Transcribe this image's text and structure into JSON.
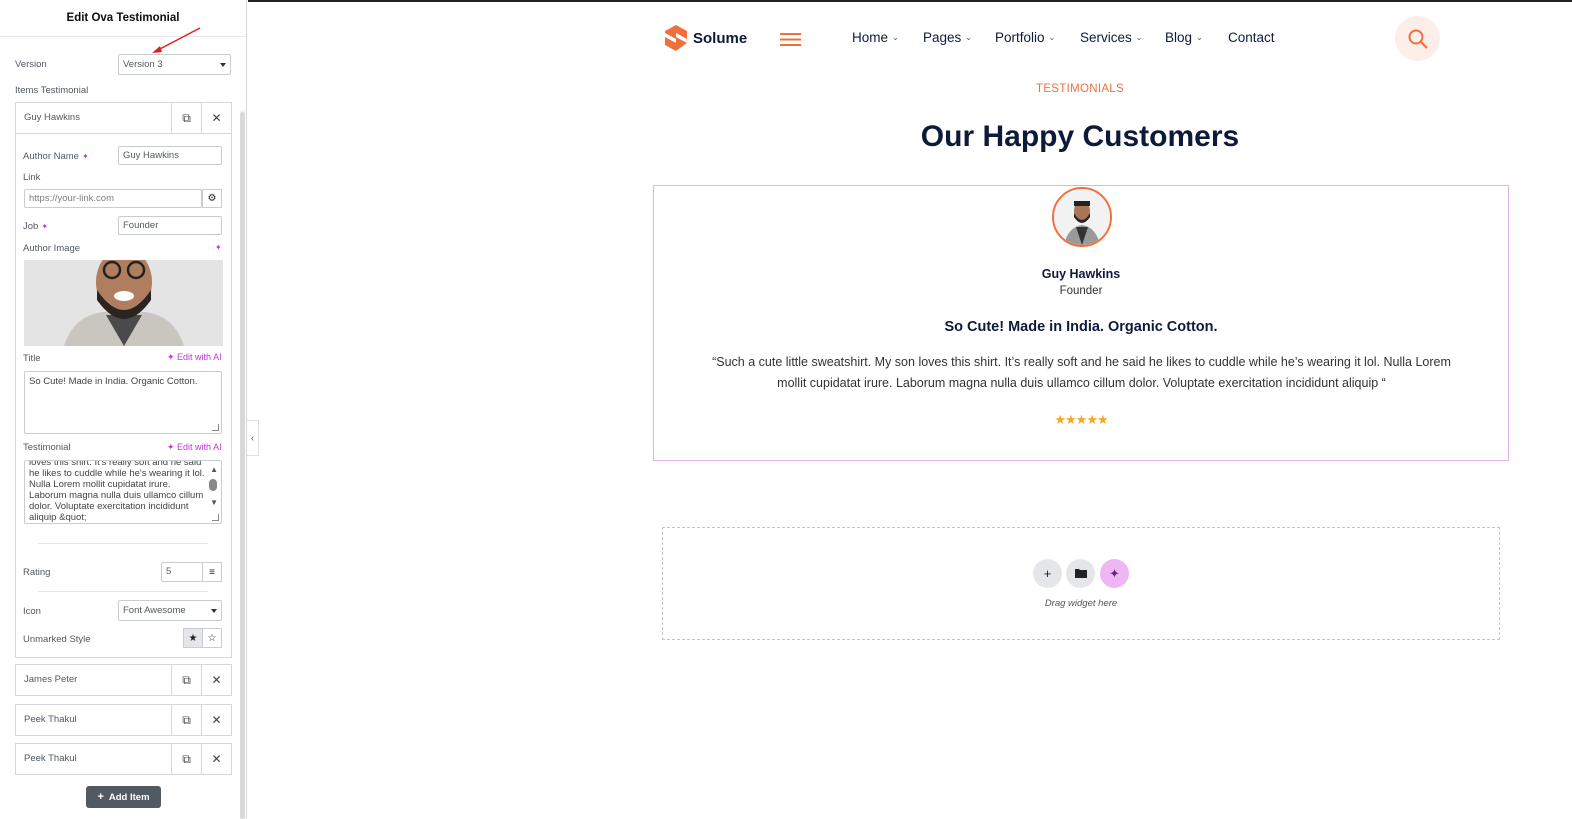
{
  "panel": {
    "title": "Edit Ova Testimonial",
    "version_label": "Version",
    "version_value": "Version 3",
    "items_label": "Items Testimonial",
    "items": [
      {
        "title": "Guy Hawkins"
      },
      {
        "title": "James Peter"
      },
      {
        "title": "Peek Thakul"
      },
      {
        "title": "Peek Thakul"
      }
    ],
    "fields": {
      "author_name_label": "Author Name",
      "author_name_value": "Guy Hawkins",
      "link_label": "Link",
      "link_placeholder": "https://your-link.com",
      "job_label": "Job",
      "job_value": "Founder",
      "author_image_label": "Author Image",
      "title_label": "Title",
      "title_value": "So Cute! Made in India. Organic Cotton.",
      "edit_with_ai": "Edit with AI",
      "testimonial_label": "Testimonial",
      "testimonial_value": "loves this shirt. It's really soft and he said he likes to cuddle while he's wearing it lol. Nulla Lorem mollit cupidatat irure. Laborum magna nulla duis ullamco cillum dolor. Voluptate exercitation incididunt aliquip &quot;",
      "rating_label": "Rating",
      "rating_value": "5",
      "icon_label": "Icon",
      "icon_value": "Font Awesome",
      "unmarked_style_label": "Unmarked Style"
    },
    "add_item_label": "Add Item"
  },
  "site": {
    "brand": "Solume",
    "brand_color": "#f0703d",
    "nav": [
      "Home",
      "Pages",
      "Portfolio",
      "Services",
      "Blog",
      "Contact"
    ]
  },
  "section": {
    "kicker": "TESTIMONIALS",
    "heading": "Our Happy Customers",
    "author_name": "Guy Hawkins",
    "author_job": "Founder",
    "title": "So Cute! Made in India. Organic Cotton.",
    "quote": "“Such a cute little sweatshirt. My son loves this shirt. It’s really soft and he said he likes to cuddle while he’s wearing it lol. Nulla Lorem mollit cupidatat irure. Laborum magna nulla duis ullamco cillum dolor. Voluptate exercitation incididunt aliquip “",
    "rating": 5,
    "stars": "★★★★★"
  },
  "dropzone": {
    "label": "Drag widget here"
  }
}
